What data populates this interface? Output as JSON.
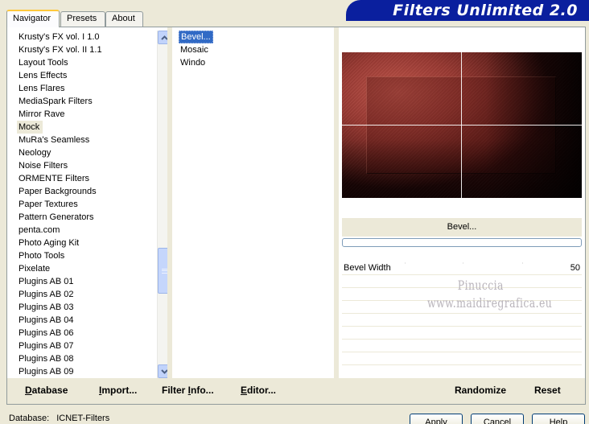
{
  "app": {
    "title": "Filters Unlimited 2.0"
  },
  "tabs": [
    {
      "label": "Navigator",
      "active": true
    },
    {
      "label": "Presets",
      "active": false
    },
    {
      "label": "About",
      "active": false
    }
  ],
  "categories": [
    "Krusty's FX vol. I 1.0",
    "Krusty's FX vol. II 1.1",
    "Layout Tools",
    "Lens Effects",
    "Lens Flares",
    "MediaSpark Filters",
    "Mirror Rave",
    "Mock",
    "MuRa's Seamless",
    "Neology",
    "Noise Filters",
    "ORMENTE Filters",
    "Paper Backgrounds",
    "Paper Textures",
    "Pattern Generators",
    "penta.com",
    "Photo Aging Kit",
    "Photo Tools",
    "Pixelate",
    "Plugins AB 01",
    "Plugins AB 02",
    "Plugins AB 03",
    "Plugins AB 04",
    "Plugins AB 06",
    "Plugins AB 07",
    "Plugins AB 08",
    "Plugins AB 09"
  ],
  "selected_category": "Mock",
  "filters": [
    "Bevel...",
    "Mosaic",
    "Windo"
  ],
  "selected_filter": "Bevel...",
  "filter_name": "Bevel...",
  "parameters": [
    {
      "label": "Bevel Width",
      "value": "50"
    }
  ],
  "watermark": {
    "line1": "Pinuccia",
    "line2": "www.maidiregrafica.eu"
  },
  "bottom_buttons": {
    "database": {
      "underlined": "D",
      "rest": "atabase"
    },
    "import": {
      "underlined": "I",
      "rest": "mport..."
    },
    "filter_info": {
      "pre": "Filter ",
      "underlined": "I",
      "rest": "nfo..."
    },
    "editor": {
      "underlined": "E",
      "rest": "ditor..."
    },
    "randomize": "Randomize",
    "reset": "Reset"
  },
  "status": {
    "label": "Database:",
    "value": "ICNET-Filters"
  },
  "dialog_buttons": {
    "apply": "Apply",
    "cancel": "Cancel",
    "help": "Help"
  },
  "colors": {
    "banner": "#0a1f9e",
    "selection": "#316ac5",
    "tab_highlight": "#ffc83c"
  }
}
